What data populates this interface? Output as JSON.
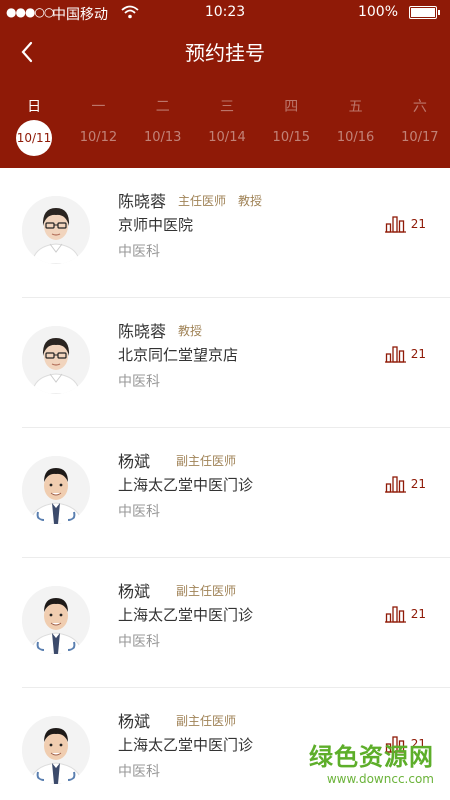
{
  "status": {
    "carrier": "中国移动",
    "time": "10:23",
    "battery": "100%"
  },
  "nav": {
    "title": "预约挂号"
  },
  "week": {
    "days": [
      "日",
      "一",
      "二",
      "三",
      "四",
      "五",
      "六"
    ],
    "dates": [
      "10/11",
      "10/12",
      "10/13",
      "10/14",
      "10/15",
      "10/16",
      "10/17"
    ],
    "selected_index": 0
  },
  "doctors": [
    {
      "name": "陈晓蓉",
      "titles": [
        "主任医师",
        "教授"
      ],
      "hospital": "京师中医院",
      "department": "中医科",
      "count": "21"
    },
    {
      "name": "陈晓蓉",
      "titles": [
        "教授"
      ],
      "hospital": "北京同仁堂望京店",
      "department": "中医科",
      "count": "21"
    },
    {
      "name": "杨斌",
      "titles": [
        "副主任医师"
      ],
      "hospital": "上海太乙堂中医门诊",
      "department": "中医科",
      "count": "21"
    },
    {
      "name": "杨斌",
      "titles": [
        "副主任医师"
      ],
      "hospital": "上海太乙堂中医门诊",
      "department": "中医科",
      "count": "21"
    },
    {
      "name": "杨斌",
      "titles": [
        "副主任医师"
      ],
      "hospital": "上海太乙堂中医门诊",
      "department": "中医科",
      "count": "21"
    }
  ],
  "watermark": {
    "main": "绿色资源网",
    "sub": "www.downcc.com"
  },
  "colors": {
    "brand": "#8f1a07",
    "tag": "#a08357",
    "muted": "#999999",
    "watermark": "#5dae2a"
  },
  "icons": {
    "back": "chevron-left-icon",
    "count": "bar-chart-icon",
    "wifi": "wifi-icon",
    "battery": "battery-icon"
  }
}
